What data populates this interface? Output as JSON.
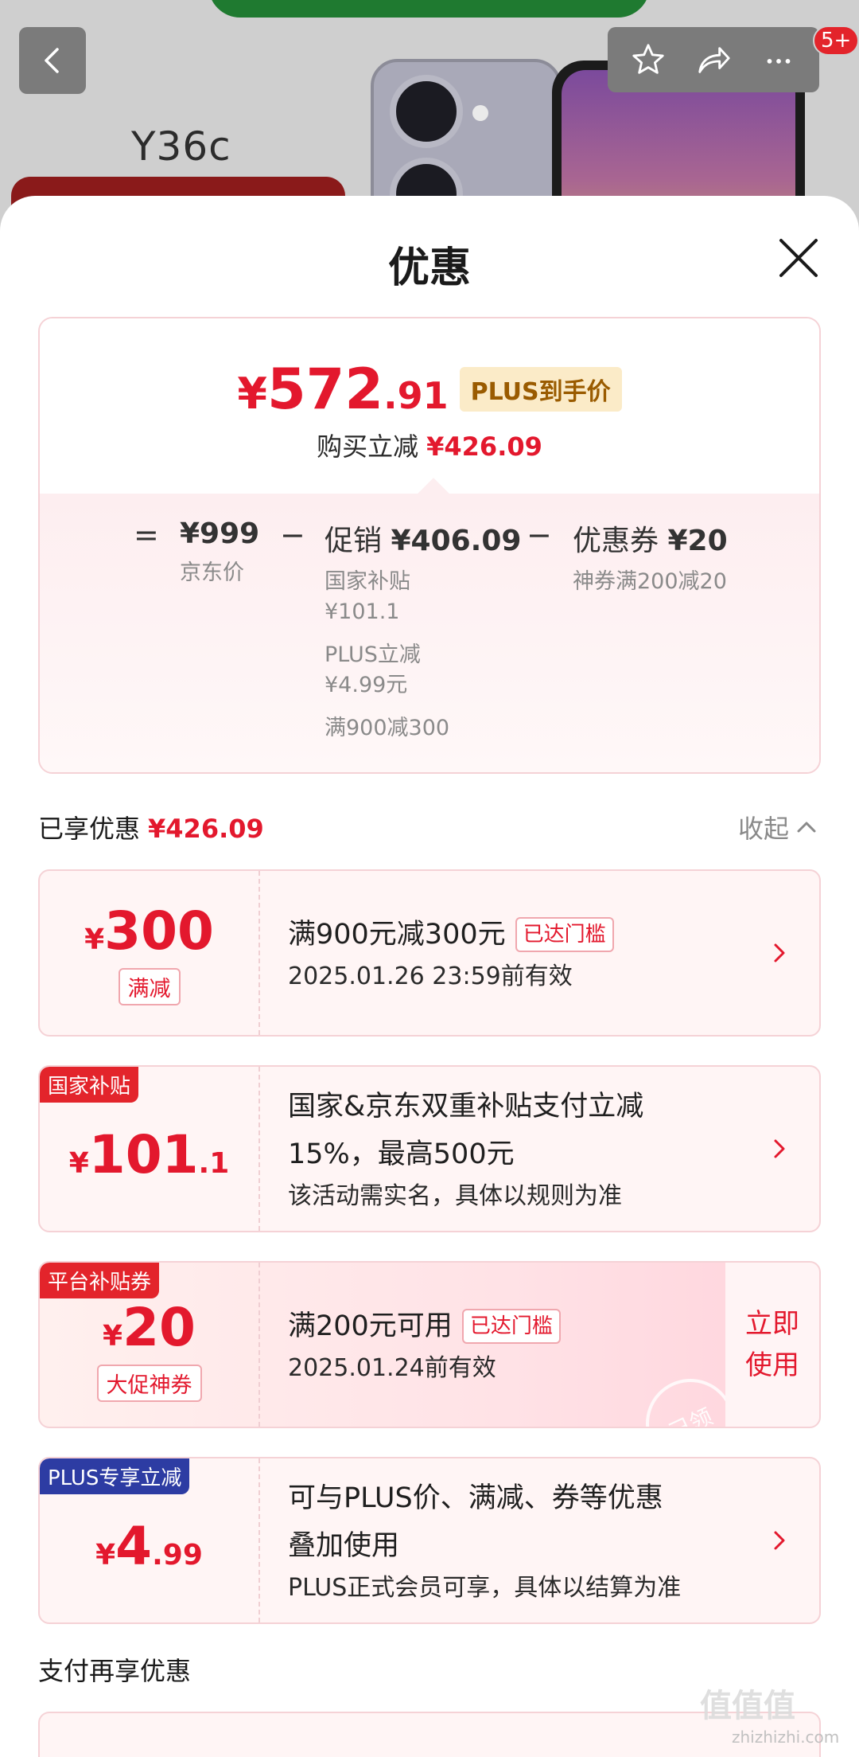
{
  "product": {
    "model": "Y36c"
  },
  "cart_badge": "5+",
  "sheet": {
    "title": "优惠"
  },
  "summary": {
    "final_yen": "¥",
    "final_int": "572",
    "final_dec": ".91",
    "plus_tag": "PLUS到手价",
    "saving_label": "购买立减",
    "saving_value": "¥426.09",
    "eq": "=",
    "minus": "−",
    "jd_price": "¥999",
    "jd_price_label": "京东价",
    "promo_label": "促销",
    "promo_value": "¥406.09",
    "promo_details": [
      "国家补贴",
      "¥101.1",
      "PLUS立减",
      "¥4.99元",
      "满900减300"
    ],
    "coupon_label": "优惠券",
    "coupon_value": "¥20",
    "coupon_detail": "神券满200减20"
  },
  "enjoyed": {
    "label": "已享优惠",
    "value": "¥426.09",
    "collapse": "收起"
  },
  "cards": [
    {
      "yen": "¥",
      "int": "300",
      "dec": "",
      "tag": "满减",
      "line1": "满900元减300元",
      "reached": "已达门槛",
      "line2": "2025.01.26 23:59前有效"
    },
    {
      "corner": "国家补贴",
      "yen": "¥",
      "int": "101",
      "dec": ".1",
      "line1": "国家&京东双重补贴支付立减",
      "line1b": "15%，最高500元",
      "line2": "该活动需实名，具体以规则为准"
    },
    {
      "corner": "平台补贴券",
      "yen": "¥",
      "int": "20",
      "dec": "",
      "tag": "大促神券",
      "line1": "满200元可用",
      "reached": "已达门槛",
      "line2": "2025.01.24前有效",
      "use1": "立即",
      "use2": "使用",
      "stamp": "已领"
    },
    {
      "corner": "PLUS专享立减",
      "yen": "¥",
      "int": "4",
      "dec": ".99",
      "line1": "可与PLUS价、满减、券等优惠",
      "line1b": "叠加使用",
      "line2": "PLUS正式会员可享，具体以结算为准"
    }
  ],
  "pay": {
    "title": "支付再享优惠"
  },
  "watermark": {
    "big": "值值值",
    "small": "zhizhizhi.com"
  },
  "colors": {
    "accent_red": "#e3182d",
    "plus_gold": "#9a5b00",
    "plus_blue": "#2d3ca3"
  }
}
